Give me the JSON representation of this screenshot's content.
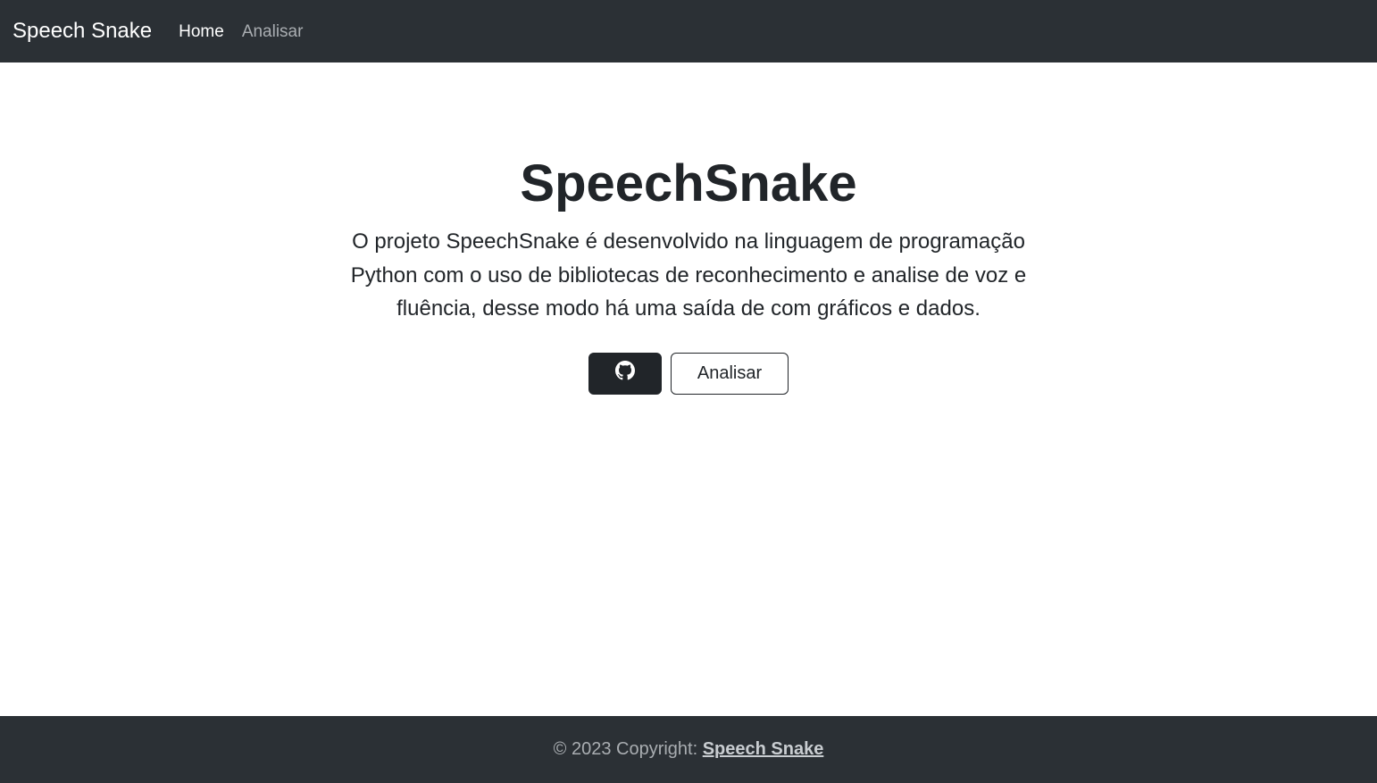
{
  "navbar": {
    "brand": "Speech Snake",
    "links": [
      {
        "label": "Home",
        "active": true
      },
      {
        "label": "Analisar",
        "active": false
      }
    ]
  },
  "hero": {
    "title": "SpeechSnake",
    "description": "O projeto SpeechSnake é desenvolvido na linguagem de programação Python com o uso de bibliotecas de reconhecimento e analise de voz e fluência, desse modo há uma saída de com gráficos e dados.",
    "github_button_icon": "github-icon",
    "analyze_button_label": "Analisar"
  },
  "footer": {
    "copyright_prefix": "© 2023 Copyright: ",
    "link_label": "Speech Snake"
  },
  "colors": {
    "navbar_bg": "#2b3035",
    "text_dark": "#212529",
    "nav_inactive": "#a9adb1"
  }
}
